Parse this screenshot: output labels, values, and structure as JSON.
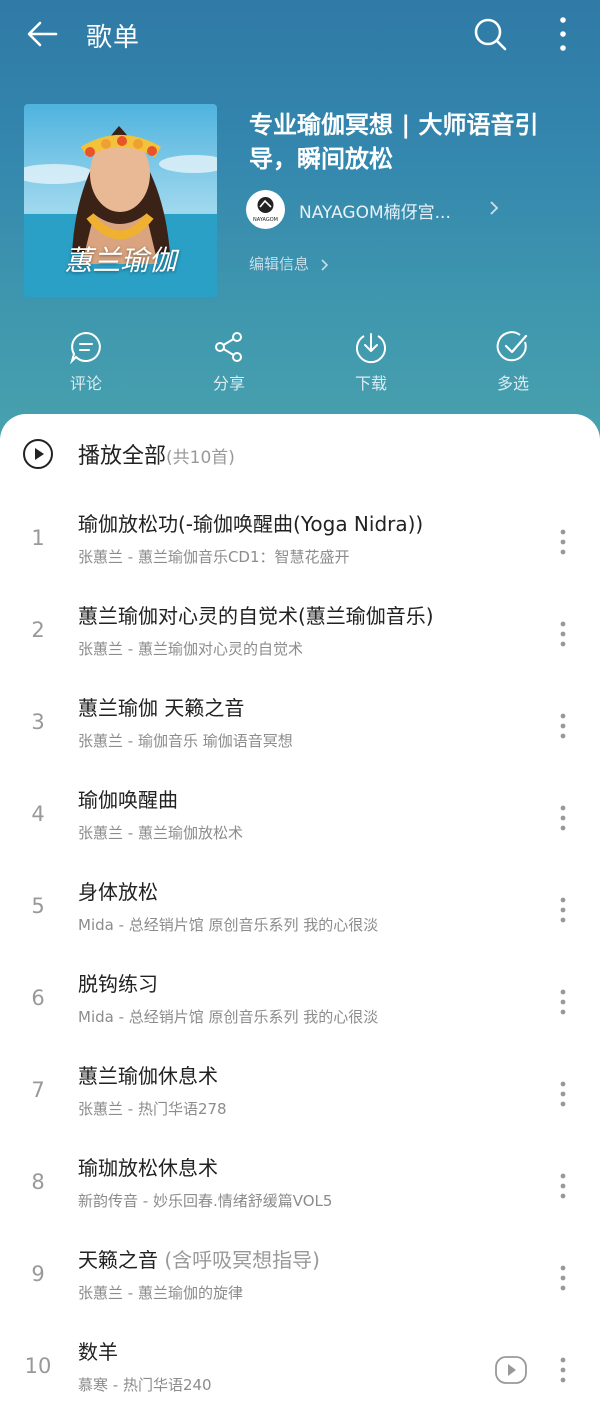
{
  "topbar": {
    "title": "歌单",
    "icons": [
      "back-arrow-icon",
      "search-icon",
      "more-vertical-icon"
    ]
  },
  "playlist": {
    "title": "专业瑜伽冥想 | 大师语音引导，瞬间放松",
    "cover_text": "蕙兰瑜伽",
    "creator": "NAYAGOM楠伢宫...",
    "creator_logo_text": "NAYAGOM",
    "edit_label": "编辑信息"
  },
  "actions": [
    {
      "label": "评论",
      "icon": "comment-icon"
    },
    {
      "label": "分享",
      "icon": "share-icon"
    },
    {
      "label": "下载",
      "icon": "download-icon"
    },
    {
      "label": "多选",
      "icon": "multi-select-icon"
    }
  ],
  "play_all": {
    "label": "播放全部",
    "count": "(共10首)"
  },
  "songs": [
    {
      "num": "1",
      "title": "瑜伽放松功(-瑜伽唤醒曲(Yoga Nidra))",
      "title_dim": "",
      "sub": "张蕙兰 - 蕙兰瑜伽音乐CD1：智慧花盛开"
    },
    {
      "num": "2",
      "title": "蕙兰瑜伽对心灵的自觉术(蕙兰瑜伽音乐)",
      "title_dim": "",
      "sub": "张蕙兰 - 蕙兰瑜伽对心灵的自觉术"
    },
    {
      "num": "3",
      "title": "蕙兰瑜伽 天籁之音",
      "title_dim": "",
      "sub": "张蕙兰 - 瑜伽音乐  瑜伽语音冥想"
    },
    {
      "num": "4",
      "title": "瑜伽唤醒曲",
      "title_dim": "",
      "sub": "张蕙兰 - 蕙兰瑜伽放松术"
    },
    {
      "num": "5",
      "title": "身体放松",
      "title_dim": "",
      "sub": "Mida - 总经销片馆 原创音乐系列 我的心很淡"
    },
    {
      "num": "6",
      "title": "脱钩练习",
      "title_dim": "",
      "sub": "Mida - 总经销片馆 原创音乐系列 我的心很淡"
    },
    {
      "num": "7",
      "title": "蕙兰瑜伽休息术",
      "title_dim": "",
      "sub": "张蕙兰 - 热门华语278"
    },
    {
      "num": "8",
      "title": "瑜珈放松休息术",
      "title_dim": "",
      "sub": "新韵传音 - 妙乐回春.情绪舒缓篇VOL5"
    },
    {
      "num": "9",
      "title": "天籁之音 ",
      "title_dim": "(含呼吸冥想指导)",
      "sub": "张蕙兰 - 蕙兰瑜伽的旋律"
    },
    {
      "num": "10",
      "title": "数羊",
      "title_dim": "",
      "sub": "慕寒 - 热门华语240",
      "has_mv": true
    }
  ],
  "colors": {
    "header_top": "#2f7aa6",
    "header_bottom": "#48a1ad",
    "text_primary": "#222222",
    "text_secondary": "#8c8c8c"
  }
}
